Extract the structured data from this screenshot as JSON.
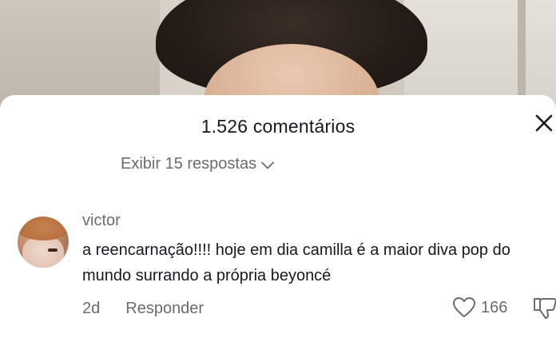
{
  "sheet": {
    "title": "1.526 comentários",
    "close_icon": "close-icon",
    "view_replies_label": "Exibir 15 respostas"
  },
  "comment": {
    "username": "victor",
    "text": "a reencarnação!!!! hoje em dia camilla é a maior diva pop do mundo surrando a própria beyoncé",
    "age": "2d",
    "reply_label": "Responder",
    "likes": "166",
    "like_icon": "heart-icon",
    "dislike_icon": "thumbs-down-icon"
  },
  "colors": {
    "text_primary": "#161823",
    "text_secondary": "#6b6b70",
    "background": "#ffffff"
  }
}
